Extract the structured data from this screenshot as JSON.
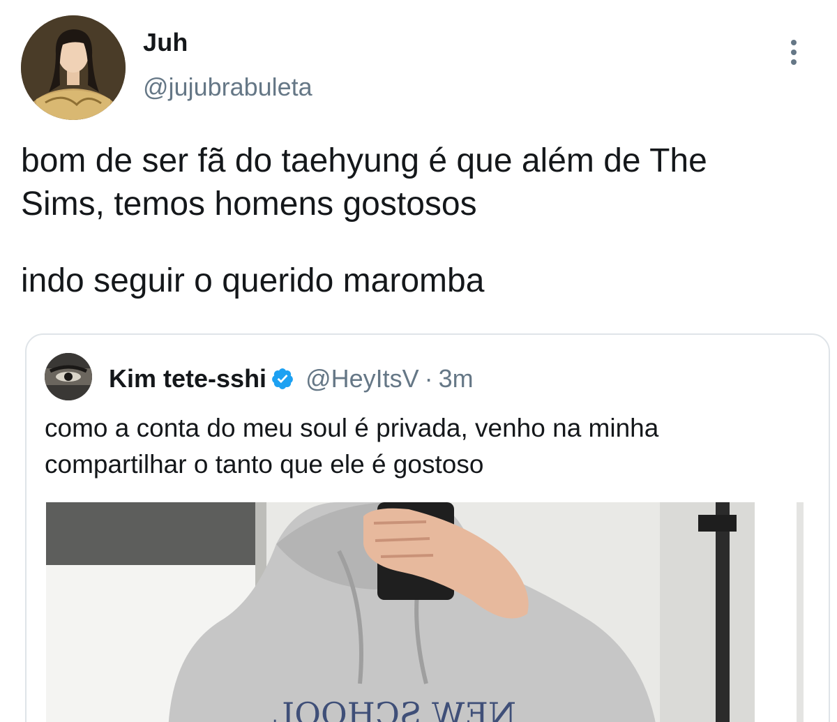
{
  "tweet": {
    "author": {
      "name": "Juh",
      "handle": "@jujubrabuleta",
      "avatar_icon": "profile-photo"
    },
    "menu_icon": "more-vertical-icon",
    "text_lines": [
      "bom de ser fã do taehyung é que além de The",
      "Sims, temos homens gostosos",
      "indo seguir o querido maromba"
    ]
  },
  "quoted_tweet": {
    "author": {
      "name": "Kim tete-sshi",
      "verified": true,
      "handle": "@HeyItsV",
      "separator": "·",
      "time": "3m"
    },
    "text_lines": [
      "como a conta do meu soul é privada, venho na minha",
      "compartilhar o tanto que ele é gostoso"
    ],
    "media": {
      "description_icon": "photo",
      "shirt_text": "NEW SCHOOL"
    }
  },
  "colors": {
    "text_primary": "#14171a",
    "text_secondary": "#657786",
    "border": "#dfe4e8",
    "verified_blue": "#1da1f2"
  }
}
